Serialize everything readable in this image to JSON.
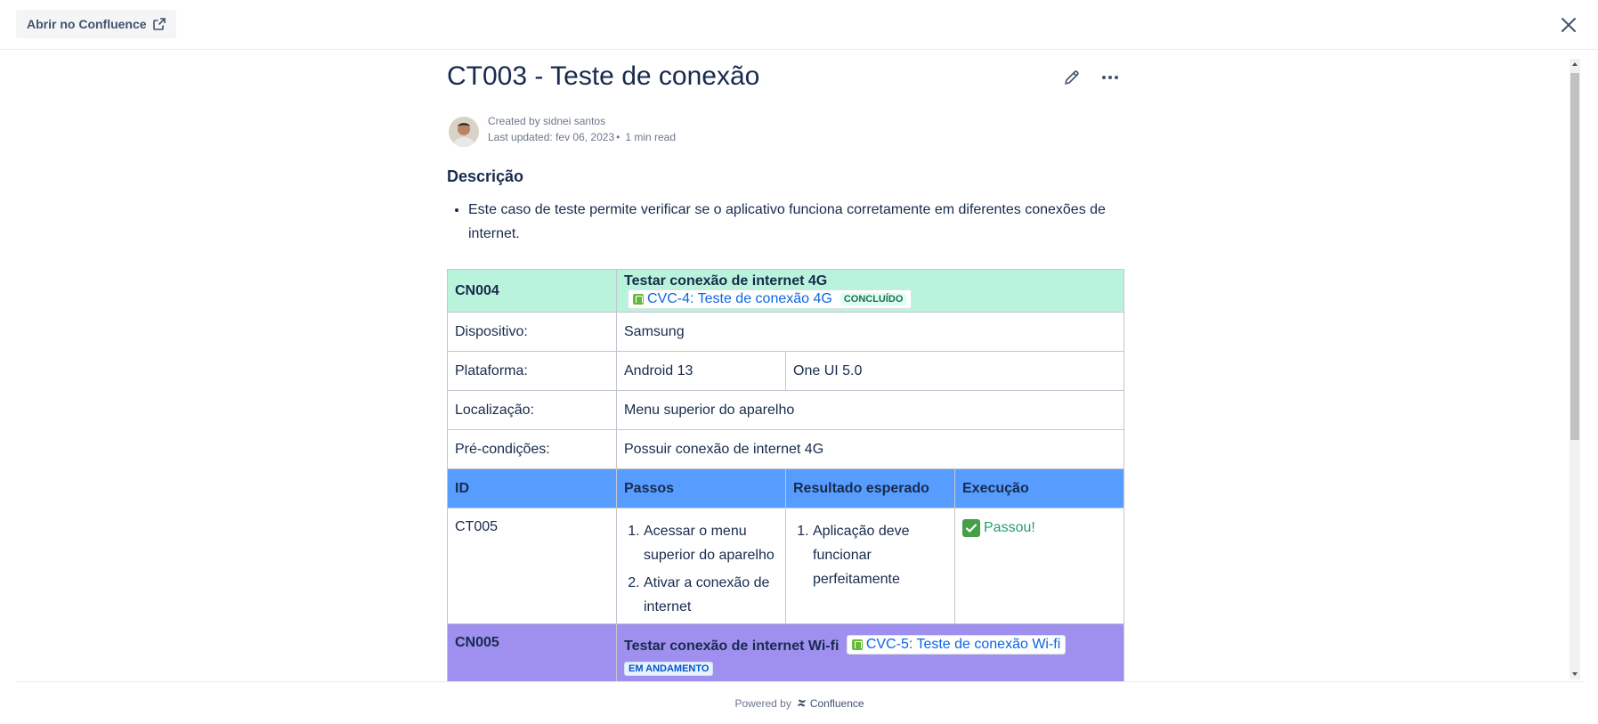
{
  "topbar": {
    "open_label": "Abrir no Confluence",
    "open_icon": "external-link-icon",
    "close_icon": "close-icon"
  },
  "page": {
    "title": "CT003 - Teste de conexão",
    "byline": {
      "created": "Created by sidnei santos",
      "updated": "Last updated: fev 06, 2023",
      "read_time": "1 min read"
    },
    "section_title": "Descrição",
    "description": "Este caso de teste permite verificar se o aplicativo funciona corretamente em diferentes conexões de internet."
  },
  "table": {
    "cn004": {
      "id": "CN004",
      "title": "Testar conexão de internet 4G",
      "jira": "CVC-4: Teste de conexão 4G",
      "status": "CONCLUÍDO"
    },
    "rows": [
      {
        "label": "Dispositivo:",
        "value": "Samsung"
      },
      {
        "label": "Plataforma:",
        "value": "Android 13",
        "value2": "One UI 5.0"
      },
      {
        "label": "Localização:",
        "value": "Menu superior do aparelho"
      },
      {
        "label": "Pré-condições:",
        "value": "Possuir conexão de internet 4G"
      }
    ],
    "headers": [
      "ID",
      "Passos",
      "Resultado esperado",
      "Execução"
    ],
    "step": {
      "id": "CT005",
      "steps": [
        "Acessar o menu superior do aparelho",
        "Ativar a conexão de internet"
      ],
      "expected": [
        "Aplicação deve funcionar perfeitamente"
      ],
      "execution": "Passou!"
    },
    "cn005": {
      "id": "CN005",
      "title": "Testar conexão de internet Wi-fi",
      "jira": "CVC-5: Teste de conexão Wi-fi",
      "status": "EM ANDAMENTO"
    }
  },
  "footer": {
    "powered": "Powered by",
    "brand": "Confluence"
  },
  "colors": {
    "green_row": "#baf3db",
    "blue_header": "#579dff",
    "purple_row": "#9f8fef",
    "link": "#0c66e4"
  }
}
